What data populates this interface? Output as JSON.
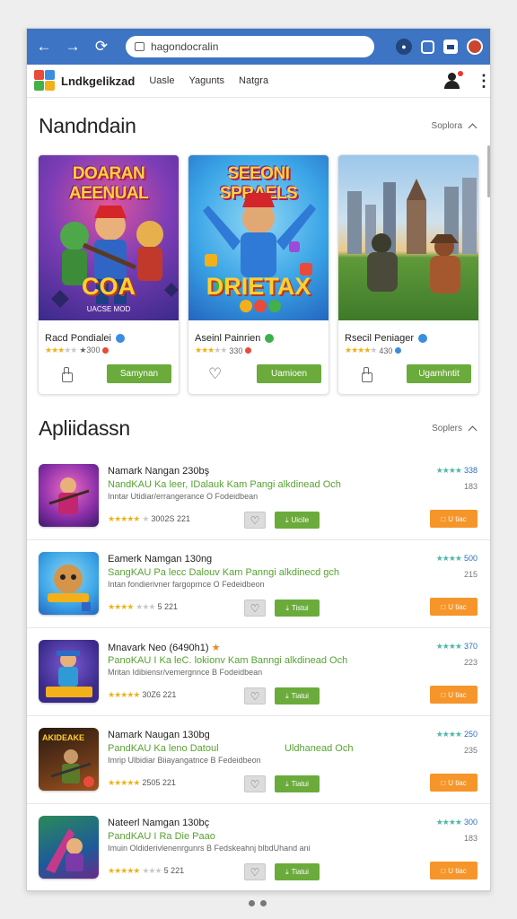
{
  "browser": {
    "url": "hagondocralin",
    "back_icon": "arrow-left-icon",
    "forward_icon": "arrow-right-icon",
    "reload_icon": "reload-icon",
    "ext_icons": [
      "extension-icon",
      "lock-icon",
      "window-icon",
      "profile-icon"
    ],
    "accent": "#3d74c4"
  },
  "appbar": {
    "brand": "Lndkgelikzad",
    "nav": [
      "Uasle",
      "Yagunts",
      "Natgra"
    ]
  },
  "featured": {
    "title": "Nandndain",
    "see_more": "Soplora",
    "cards": [
      {
        "art_top": "DOARAN AEENUAL",
        "art_bottom": "COA",
        "art_caption": "UACSE MOD",
        "name": "Racd Pondialei",
        "rating": "★300",
        "action": "Samynan",
        "like_icon": "thumbs-up-icon",
        "badge_color": "#3b8de0"
      },
      {
        "art_top": "SEEONI SPRAELS",
        "art_bottom": "DRIETAX",
        "art_caption": "",
        "name": "Aseinl Painrien",
        "rating": "330",
        "action": "Uamioen",
        "like_icon": "heart-icon",
        "badge_color": "#3cb04a"
      },
      {
        "art_top": "",
        "art_bottom": "",
        "art_caption": "",
        "name": "Rsecil Peniager",
        "rating": "430",
        "action": "Ugamhntit",
        "like_icon": "thumbs-up-icon",
        "badge_color": "#3b8de0"
      }
    ]
  },
  "apps": {
    "title": "Apliidassn",
    "see_more": "Soplers",
    "rows": [
      {
        "title": "Namark Nangan 230bş",
        "sub": "NandKAU Ka leer, IDalauk Kam Pangi alkdinead Och",
        "desc": "Inntar Utidiar/errangerance O Fodeidbean",
        "reviews": "3002S 221",
        "score": "338",
        "count": "183",
        "action": "Uicile",
        "open": "U tiac"
      },
      {
        "title": "Eamerk Namgan 130ng",
        "sub": "SangKAU Pa lecc Dalouv Kam Panngi alkdinecd gch",
        "desc": "Intan fondierivner fargoprnce O Fedeidbeon",
        "reviews": "5 221",
        "score": "500",
        "count": "215",
        "action": "Tistui",
        "open": "U tiac"
      },
      {
        "title": "Mnavark Neo (6490h1)",
        "sub": "PanoKAU I Ka leC. lokionv Kam Banngi alkdinead Och",
        "desc": "Mritan Idibiensr/vemergnnce B Fodeidbean",
        "reviews": "30Z6 221",
        "score": "370",
        "count": "223",
        "action": "Tiatui",
        "open": "U tiac"
      },
      {
        "title": "Namark Naugan 130bg",
        "sub": "PandKAU Ka leno Datoul",
        "sub_right": "Uldhanead Och",
        "desc": "Imrip Ulbidiar Biiayangatnce B Fedeidbeon",
        "reviews": "2505 221",
        "score": "250",
        "count": "235",
        "action": "Tiatui",
        "open": "U tiac"
      },
      {
        "title": "Nateerl Namgan 130bç",
        "sub": "PandKAU I Ra Die Paao",
        "desc": "Imuin Oldiderivlenenrgunrs B Fedskeahnj blbdUhand ani",
        "reviews": "5 221",
        "score": "300",
        "count": "183",
        "action": "Tiatui",
        "open": "U tiac"
      }
    ]
  }
}
